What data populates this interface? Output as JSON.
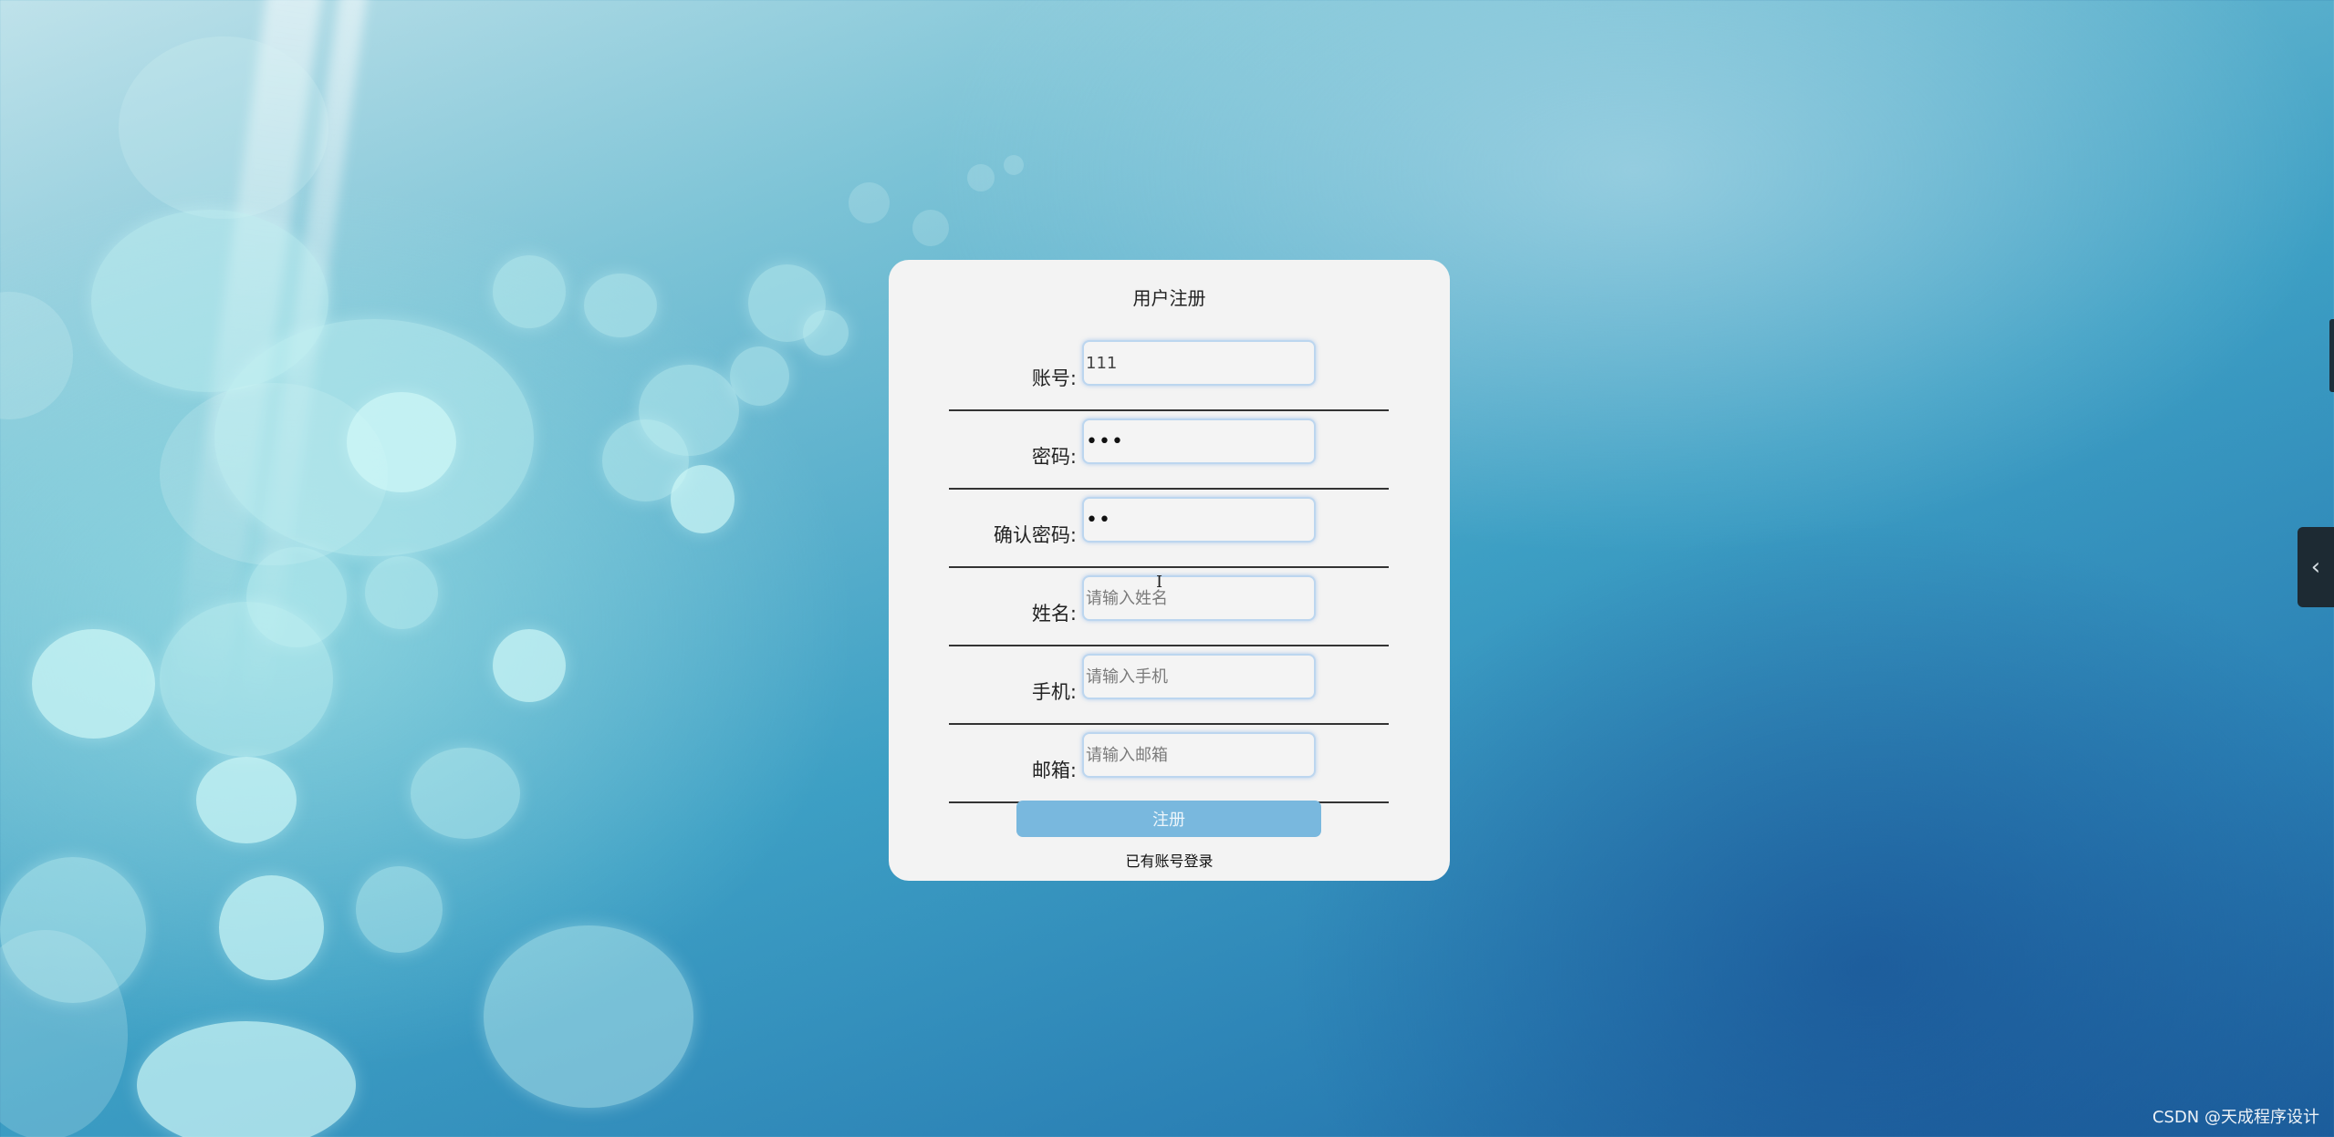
{
  "form": {
    "title": "用户注册",
    "fields": [
      {
        "label": "账号:",
        "value": "111",
        "placeholder": "",
        "type": "text"
      },
      {
        "label": "密码:",
        "value": "123",
        "placeholder": "",
        "type": "password"
      },
      {
        "label": "确认密码:",
        "value": "12",
        "placeholder": "",
        "type": "password"
      },
      {
        "label": "姓名:",
        "value": "",
        "placeholder": "请输入姓名",
        "type": "text"
      },
      {
        "label": "手机:",
        "value": "",
        "placeholder": "请输入手机",
        "type": "text"
      },
      {
        "label": "邮箱:",
        "value": "",
        "placeholder": "请输入邮箱",
        "type": "text"
      }
    ],
    "submit_label": "注册",
    "login_link": "已有账号登录"
  },
  "side_tab": {
    "icon": "chevron-left-icon",
    "glyph": "‹"
  },
  "watermark": "CSDN @天成程序设计",
  "colors": {
    "card_bg": "#f3f3f3",
    "submit_bg": "#79b8de",
    "side_tab_bg": "#1d2a33"
  }
}
